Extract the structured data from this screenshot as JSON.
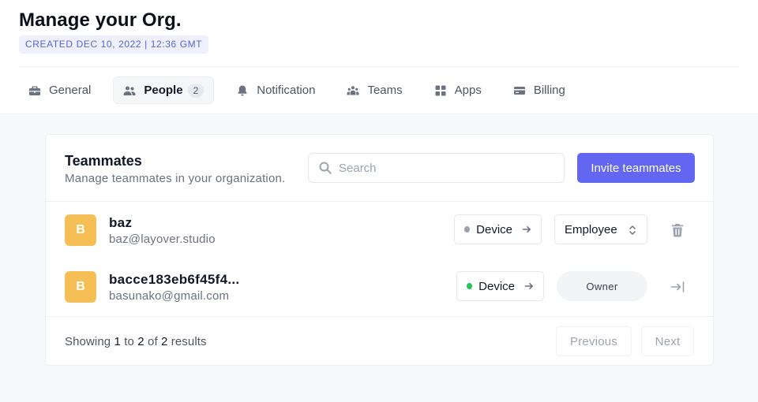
{
  "header": {
    "title": "Manage your Org.",
    "created": "CREATED DEC 10, 2022 | 12:36 GMT"
  },
  "tabs": [
    {
      "label": "General",
      "icon": "briefcase-icon"
    },
    {
      "label": "People",
      "icon": "users-icon",
      "count": "2",
      "active": true
    },
    {
      "label": "Notification",
      "icon": "bell-icon"
    },
    {
      "label": "Teams",
      "icon": "team-icon"
    },
    {
      "label": "Apps",
      "icon": "grid-icon"
    },
    {
      "label": "Billing",
      "icon": "credit-card-icon"
    }
  ],
  "teammates": {
    "title": "Teammates",
    "subtitle": "Manage teammates in your organization.",
    "search_placeholder": "Search",
    "invite_label": "Invite teammates",
    "members": [
      {
        "initial": "B",
        "name": "baz",
        "email": "baz@layover.studio",
        "device_label": "Device",
        "device_status_color": "#9ca3af",
        "role": "Employee",
        "action_icon": "trash-icon"
      },
      {
        "initial": "B",
        "name": "bacce183eb6f45f4...",
        "email": "basunako@gmail.com",
        "device_label": "Device",
        "device_status_color": "#22c55e",
        "role": "Owner",
        "action_icon": "leave-icon"
      }
    ],
    "footer": {
      "showing": "Showing",
      "from": "1",
      "to_word": "to",
      "to": "2",
      "of_word": "of",
      "total": "2",
      "results_word": "results",
      "previous": "Previous",
      "next": "Next"
    }
  },
  "colors": {
    "accent": "#6366f1",
    "avatar": "#f5bf55",
    "badge_bg": "#eef0fd",
    "badge_text": "#5b63d3"
  }
}
